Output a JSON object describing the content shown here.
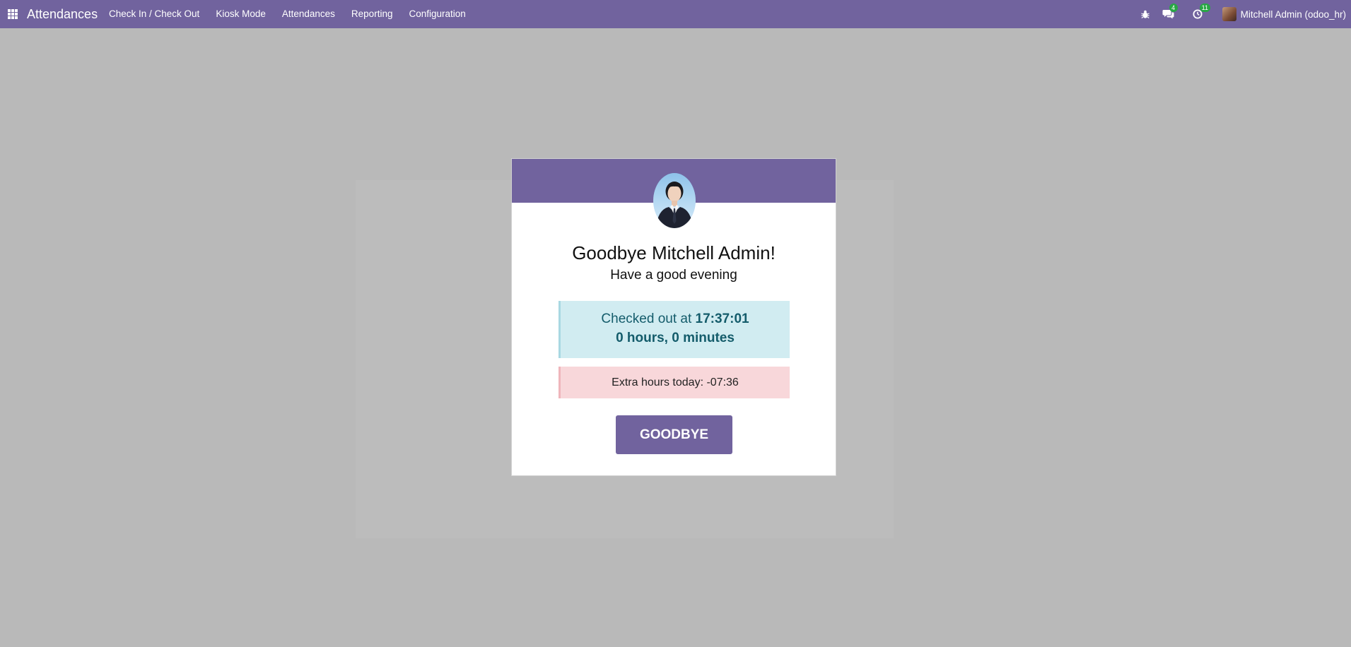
{
  "navbar": {
    "app_title": "Attendances",
    "menu": [
      {
        "label": "Check In / Check Out"
      },
      {
        "label": "Kiosk Mode"
      },
      {
        "label": "Attendances"
      },
      {
        "label": "Reporting"
      },
      {
        "label": "Configuration"
      }
    ],
    "systray": {
      "debug_icon": "bug-icon",
      "messages_icon": "chat-icon",
      "messages_count": "4",
      "activities_icon": "clock-icon",
      "activities_count": "11",
      "user_name": "Mitchell Admin (odoo_hr)"
    }
  },
  "card": {
    "greeting": "Goodbye Mitchell Admin!",
    "subgreeting": "Have a good evening",
    "checked_out_prefix": "Checked out at",
    "checked_out_time": "17:37:01",
    "duration": "0 hours, 0 minutes",
    "extra_hours": "Extra hours today: -07:36",
    "button_label": "GOODBYE"
  },
  "colors": {
    "brand": "#71639e",
    "background": "#b9b9b9",
    "info_bg": "#d1ecf1",
    "danger_bg": "#f8d7da",
    "badge": "#28a745"
  }
}
